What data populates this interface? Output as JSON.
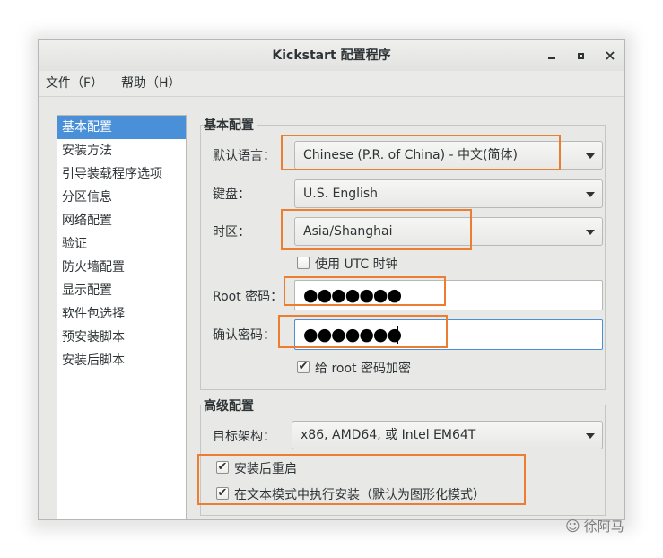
{
  "window": {
    "title": "Kickstart 配置程序"
  },
  "window_controls": {
    "minimize": "_",
    "maximize": "□",
    "close": "✕"
  },
  "menubar": {
    "file": "文件（F）",
    "help": "帮助（H）"
  },
  "sidebar": {
    "items": [
      {
        "label": "基本配置",
        "selected": true
      },
      {
        "label": "安装方法"
      },
      {
        "label": "引导装载程序选项"
      },
      {
        "label": "分区信息"
      },
      {
        "label": "网络配置"
      },
      {
        "label": "验证"
      },
      {
        "label": "防火墙配置"
      },
      {
        "label": "显示配置"
      },
      {
        "label": "软件包选择"
      },
      {
        "label": "预安装脚本"
      },
      {
        "label": "安装后脚本"
      }
    ]
  },
  "basic": {
    "section_title": "基本配置",
    "language_label": "默认语言：",
    "language_value": "Chinese (P.R. of China) - 中文(简体)",
    "keyboard_label": "键盘：",
    "keyboard_value": "U.S. English",
    "timezone_label": "时区：",
    "timezone_value": "Asia/Shanghai",
    "utc_label": "使用  UTC 时钟",
    "utc_checked": false,
    "root_password_label": "Root 密码：",
    "root_password_masked": "●●●●●●●",
    "confirm_password_label": "确认密码：",
    "confirm_password_masked": "●●●●●●●",
    "encrypt_label": "给  root 密码加密",
    "encrypt_checked": true
  },
  "advanced": {
    "section_title": "高级配置",
    "arch_label": "目标架构：",
    "arch_value": "x86, AMD64, 或  Intel EM64T",
    "reboot_label": "安装后重启",
    "reboot_checked": true,
    "textmode_label": "在文本模式中执行安装（默认为图形化模式）",
    "textmode_checked": true
  },
  "colors": {
    "highlight": "#ed7d31",
    "selection": "#4a90d9",
    "focus": "#4a90d9"
  },
  "watermark": {
    "text": "徐阿马",
    "icon": "wechat-icon"
  }
}
